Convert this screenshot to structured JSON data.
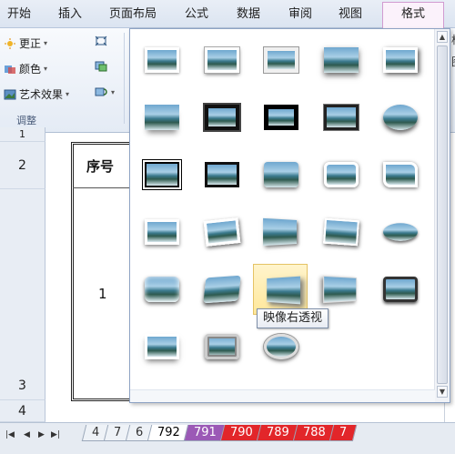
{
  "ribbon_tabs": [
    "开始",
    "插入",
    "页面布局",
    "公式",
    "数据",
    "审阅",
    "视图",
    "格式"
  ],
  "ribbon": {
    "correct_label": "更正",
    "color_label": "颜色",
    "artistic_label": "艺术效果",
    "group_label": "调整",
    "right_partial_1": "析",
    "right_partial_2": "图"
  },
  "sheet": {
    "rows": [
      "1",
      "2",
      "3",
      "4"
    ],
    "header_cell": "序号",
    "value_cell": "1"
  },
  "gallery": {
    "tooltip": "映像右透视",
    "hovered_index": 22,
    "item_count": 28
  },
  "sheet_tabs": [
    "4",
    "7",
    "6",
    "792",
    "791",
    "790",
    "789",
    "788",
    "7"
  ],
  "sheet_tab_colors": [
    "#eef2f7",
    "#eef2f7",
    "#eef2f7",
    "#ffffff",
    "#9b59b6",
    "#e2262a",
    "#e2262a",
    "#e2262a",
    "#e2262a"
  ],
  "accent_format_tab": "#d19bd1"
}
